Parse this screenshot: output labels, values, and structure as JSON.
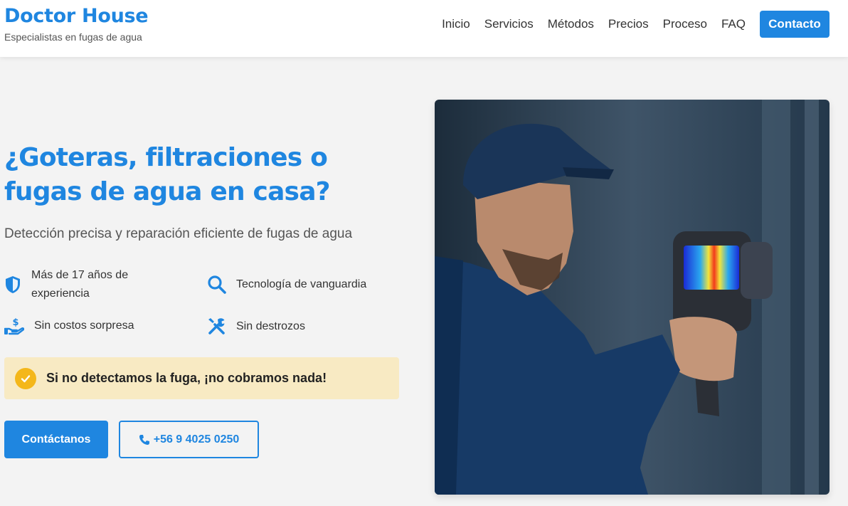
{
  "header": {
    "brand_name": "Doctor House",
    "brand_tagline": "Especialistas en fugas de agua",
    "nav": [
      "Inicio",
      "Servicios",
      "Métodos",
      "Precios",
      "Proceso",
      "FAQ"
    ],
    "cta_label": "Contacto"
  },
  "hero": {
    "title": "¿Goteras, filtraciones o fugas de agua en casa?",
    "subtitle": "Detección precisa y reparación eficiente de fugas de agua",
    "features": [
      {
        "icon": "shield-icon",
        "text": "Más de 17 años de experiencia"
      },
      {
        "icon": "search-icon",
        "text": "Tecnología de vanguardia"
      },
      {
        "icon": "money-hand-icon",
        "text": "Sin costos sorpresa"
      },
      {
        "icon": "tools-icon",
        "text": "Sin destrozos"
      }
    ],
    "guarantee": "Si no detectamos la fuga, ¡no cobramos nada!",
    "primary_button": "Contáctanos",
    "phone_button": "+56 9 4025 0250",
    "image_description": "technician-with-thermal-camera"
  },
  "colors": {
    "accent": "#1f86e0",
    "guarantee_bg": "#f8eac3",
    "check": "#f4b71a",
    "page_bg": "#f3f3f3"
  }
}
